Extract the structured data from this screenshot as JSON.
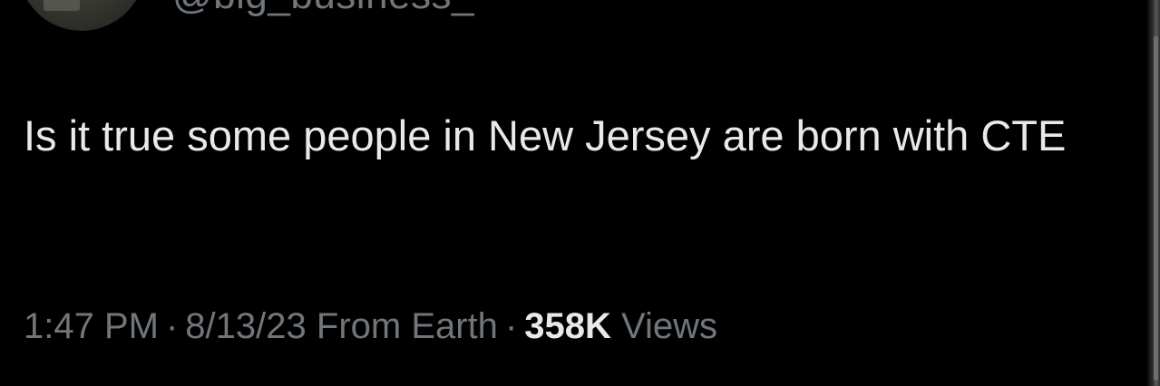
{
  "author": {
    "handle": "@big_business_"
  },
  "tweet": {
    "text": "Is it true some people in New Jersey are born with CTE"
  },
  "meta": {
    "time": "1:47 PM",
    "separator": "·",
    "date": "8/13/23",
    "source": "From Earth",
    "views_count": "358K",
    "views_label": "Views"
  },
  "colors": {
    "background": "#000000",
    "primary_text": "#e7e9ea",
    "secondary_text": "#71767b"
  },
  "icons": [
    "avatar"
  ]
}
